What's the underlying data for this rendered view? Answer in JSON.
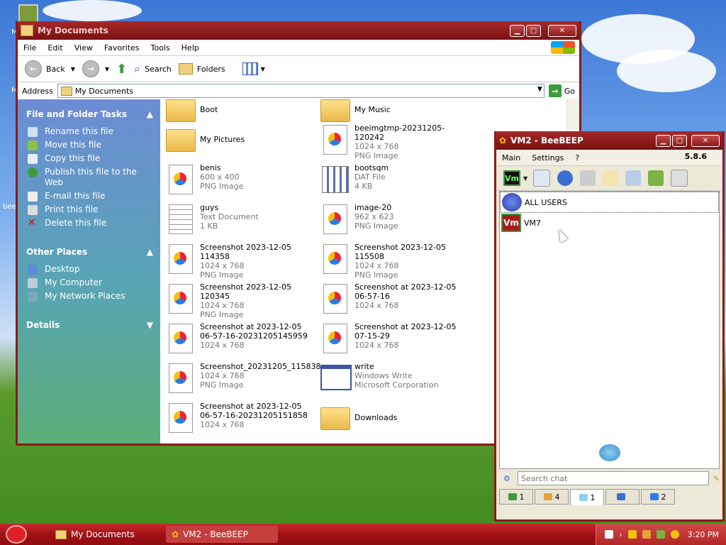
{
  "colors": {
    "titlebar": "#8b1a1a",
    "taskbar": "#a01216",
    "accent": "#2c7be5"
  },
  "explorer": {
    "title": "My Documents",
    "menu": [
      "File",
      "Edit",
      "View",
      "Favorites",
      "Tools",
      "Help"
    ],
    "toolbar": {
      "back": "Back",
      "search": "Search",
      "folders": "Folders"
    },
    "address": {
      "label": "Address",
      "value": "My Documents",
      "go": "Go"
    },
    "file_tasks": {
      "title": "File and Folder Tasks",
      "items": [
        "Rename this file",
        "Move this file",
        "Copy this file",
        "Publish this file to the Web",
        "E-mail this file",
        "Print this file",
        "Delete this file"
      ]
    },
    "other_places": {
      "title": "Other Places",
      "items": [
        "Desktop",
        "My Computer",
        "My Network Places"
      ]
    },
    "details": {
      "title": "Details"
    },
    "files": [
      {
        "name": "Boot",
        "line2": "",
        "line3": "",
        "icon": "folder-icon"
      },
      {
        "name": "My Music",
        "line2": "",
        "line3": "",
        "icon": "folder-icon"
      },
      {
        "name": "My Pictures",
        "line2": "",
        "line3": "",
        "icon": "folder-icon"
      },
      {
        "name": "beeimgtmp-20231205-120242",
        "line2": "1024 x 768",
        "line3": "PNG Image",
        "icon": "png-icon"
      },
      {
        "name": "benis",
        "line2": "600 x 400",
        "line3": "PNG Image",
        "icon": "png-icon"
      },
      {
        "name": "bootsqm",
        "line2": "DAT File",
        "line3": "4 KB",
        "icon": "dat-icon"
      },
      {
        "name": "guys",
        "line2": "Text Document",
        "line3": "1 KB",
        "icon": "txt-icon"
      },
      {
        "name": "image-20",
        "line2": "962 x 623",
        "line3": "PNG Image",
        "icon": "png-icon"
      },
      {
        "name": "Screenshot 2023-12-05 114358",
        "line2": "1024 x 768",
        "line3": "PNG Image",
        "icon": "png-icon"
      },
      {
        "name": "Screenshot 2023-12-05 115508",
        "line2": "1024 x 768",
        "line3": "PNG Image",
        "icon": "png-icon"
      },
      {
        "name": "Screenshot 2023-12-05 120345",
        "line2": "1024 x 768",
        "line3": "PNG Image",
        "icon": "png-icon"
      },
      {
        "name": "Screenshot at 2023-12-05",
        "line2": "06-57-16",
        "line3": "1024 x 768",
        "icon": "png-icon"
      },
      {
        "name": "Screenshot at 2023-12-05",
        "line2": "06-57-16-20231205145959",
        "line3": "1024 x 768",
        "icon": "png-icon"
      },
      {
        "name": "Screenshot at 2023-12-05",
        "line2": "07-15-29",
        "line3": "1024 x 768",
        "icon": "png-icon"
      },
      {
        "name": "Screenshot_20231205_115838",
        "line2": "1024 x 768",
        "line3": "PNG Image",
        "icon": "png-icon"
      },
      {
        "name": "write",
        "line2": "Windows Write",
        "line3": "Microsoft Corporation",
        "icon": "app-icon"
      },
      {
        "name": "Screenshot at 2023-12-05",
        "line2": "06-57-16-20231205151858",
        "line3": "1024 x 768",
        "icon": "png-icon"
      },
      {
        "name": "Downloads",
        "line2": "",
        "line3": "",
        "icon": "folder-icon"
      }
    ]
  },
  "bee": {
    "title": "VM2 - BeeBEEP",
    "menu": [
      "Main",
      "Settings",
      "?"
    ],
    "version": "5.8.6",
    "users": [
      {
        "name": "ALL USERS",
        "avatar": ""
      },
      {
        "name": "VM7",
        "avatar": "Vm"
      }
    ],
    "my_avatar": "Vm",
    "search_placeholder": "Search chat",
    "tabs": [
      "1",
      "4",
      "1",
      "",
      "2"
    ]
  },
  "taskbar": {
    "items": [
      "My Documents",
      "VM2 - BeeBEEP"
    ],
    "time": "3:20 PM"
  },
  "desktop": {
    "edge_texts": [
      "M",
      "bee",
      "M"
    ]
  }
}
